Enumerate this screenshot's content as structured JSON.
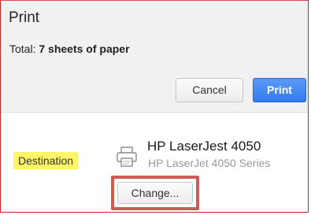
{
  "dialog": {
    "title": "Print",
    "total_label": "Total:",
    "total_value": "7 sheets of paper"
  },
  "buttons": {
    "cancel": "Cancel",
    "print": "Print",
    "change": "Change..."
  },
  "destination": {
    "label": "Destination",
    "printer_name": "HP LaserJest 4050",
    "printer_series": "HP LaserJet 4050 Series",
    "icon": "printer-icon"
  },
  "colors": {
    "print_button": "#3479ee",
    "destination_highlight": "#fff566",
    "change_highlight_border": "#cf5b56",
    "frame_border": "#c8252b"
  }
}
